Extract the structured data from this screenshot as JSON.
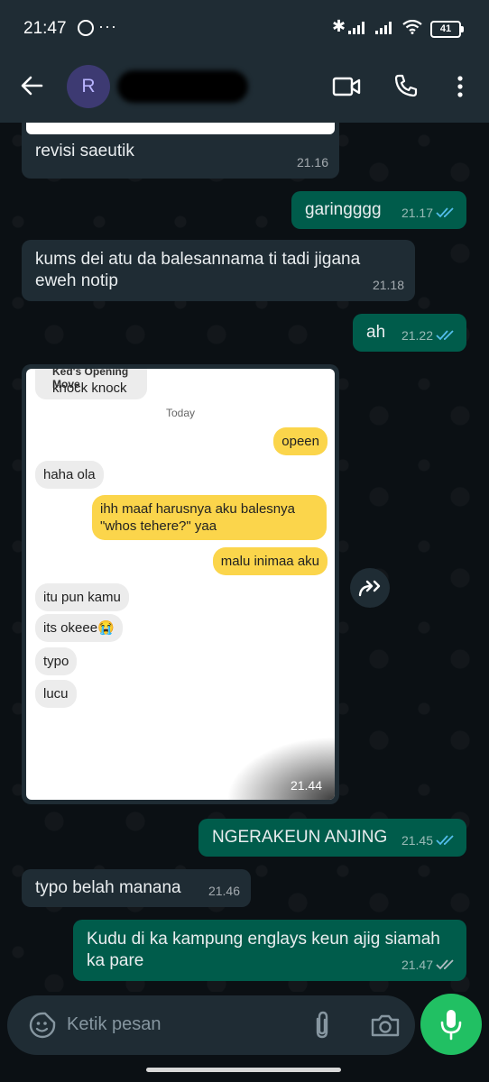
{
  "status_bar": {
    "time": "21:47",
    "dots": "···",
    "battery": "41"
  },
  "header": {
    "avatar_letter": "R",
    "contact_name": ""
  },
  "messages": [
    {
      "dir": "in",
      "text": "revisi saeutik",
      "time": "21.16"
    },
    {
      "dir": "out",
      "text": "garingggg",
      "time": "21.17"
    },
    {
      "dir": "in",
      "text": "kums dei atu da balesannama ti tadi jigana eweh notip",
      "time": "21.18"
    },
    {
      "dir": "out",
      "text": "ah",
      "time": "21.22"
    },
    {
      "dir": "in",
      "type": "image",
      "time": "21.44"
    },
    {
      "dir": "out",
      "text": "NGERAKEUN ANJING",
      "time": "21.45"
    },
    {
      "dir": "in",
      "text": "typo belah manana",
      "time": "21.46"
    },
    {
      "dir": "out",
      "text": "Kudu di ka kampung englays keun ajig siamah ka pare",
      "time": "21.47"
    }
  ],
  "image_content": {
    "cut_header": "Ked's Opening Move",
    "first_in": "knock knock",
    "day_label": "Today",
    "bubbles": [
      {
        "dir": "out",
        "text": "opeen"
      },
      {
        "dir": "in",
        "text": "haha ola"
      },
      {
        "dir": "out",
        "text": "ihh maaf harusnya aku balesnya \"whos tehere?\" yaa"
      },
      {
        "dir": "out",
        "text": "malu inimaa aku"
      },
      {
        "dir": "in",
        "text": "itu pun kamu"
      },
      {
        "dir": "in",
        "text": "its okeee😭"
      },
      {
        "dir": "in",
        "text": "typo"
      },
      {
        "dir": "in",
        "text": "lucu"
      }
    ]
  },
  "input": {
    "placeholder": "Ketik pesan"
  },
  "colors": {
    "header": "#1f2c34",
    "incoming": "#1f2c34",
    "outgoing": "#005c4b",
    "tick_read": "#53bdeb",
    "mic": "#21c063"
  }
}
